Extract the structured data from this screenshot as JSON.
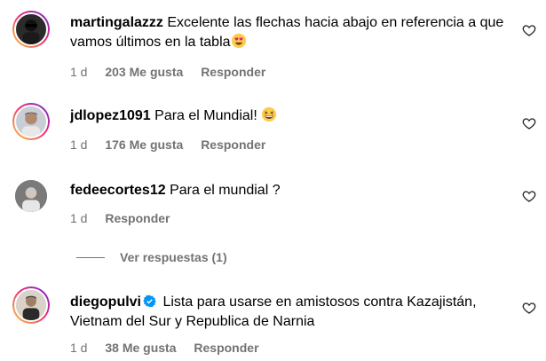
{
  "comments": [
    {
      "username": "martingalazzz",
      "text": "Excelente las flechas hacia abajo en referencia a que vamos últimos en la tabla",
      "time": "1 d",
      "likes": "203 Me gusta",
      "reply": "Responder",
      "emoji": "smiling-face-with-heart-eyes",
      "story_ring": true
    },
    {
      "username": "jdlopez1091",
      "text": "Para el Mundial!",
      "time": "1 d",
      "likes": "176 Me gusta",
      "reply": "Responder",
      "emoji": "grinning-squinting-face",
      "story_ring": true
    },
    {
      "username": "fedeecortes12",
      "text": "Para el mundial ?",
      "time": "1 d",
      "reply": "Responder",
      "story_ring": false
    },
    {
      "username": "diegopulvi",
      "verified": true,
      "text": "Lista para usarse en amistosos contra Kazajistán, Vietnam del Sur y Republica de Narnia",
      "time": "1 d",
      "likes": "38 Me gusta",
      "reply": "Responder",
      "story_ring": true
    }
  ],
  "view_replies": "Ver respuestas (1)",
  "icons": {
    "like": "heart-outline-icon",
    "verified": "verified-badge-icon"
  },
  "colors": {
    "secondary_text": "#737373",
    "verified_blue": "#0095f6",
    "story_ring_start": "#f9ce34",
    "story_ring_end": "#6228d7"
  }
}
